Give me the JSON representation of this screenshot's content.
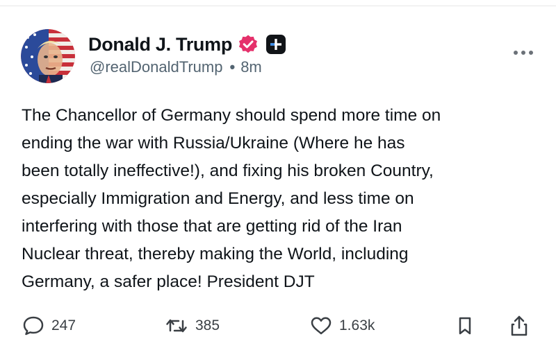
{
  "author": {
    "display_name": "Donald J. Trump",
    "handle": "@realDonaldTrump",
    "separator": "•",
    "time_ago": "8m",
    "verified_color": "#e0245e"
  },
  "post": {
    "text": "The Chancellor of Germany should spend more time on\nending the war with Russia/Ukraine (Where he has\nbeen totally ineffective!), and fixing his broken Country,\nespecially Immigration and Energy, and less time on\ninterfering with those that are getting rid of the Iran\nNuclear threat, thereby making the World, including\nGermany, a safer place! President DJT"
  },
  "actions": {
    "replies": "247",
    "reposts": "385",
    "likes": "1.63k"
  },
  "icons": {
    "more": "ellipsis-icon",
    "reply": "comment-bubble-icon",
    "repost": "repost-arrows-icon",
    "like": "heart-icon",
    "bookmark": "bookmark-icon",
    "share": "share-icon",
    "verified": "verified-badge-icon",
    "plus": "plus-badge-icon"
  }
}
